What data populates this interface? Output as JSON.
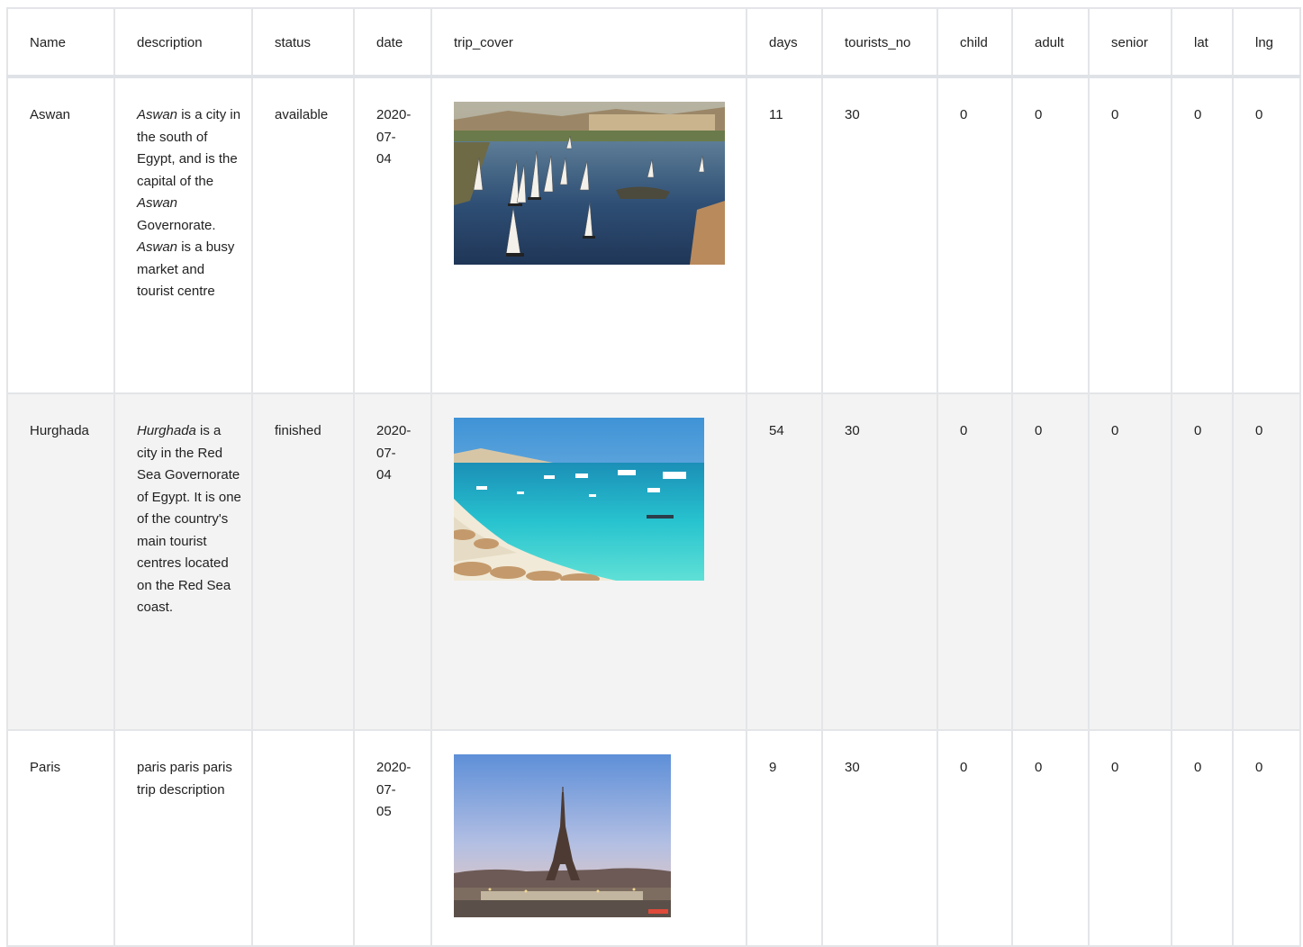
{
  "table": {
    "columns": [
      "Name",
      "description",
      "status",
      "date",
      "trip_cover",
      "days",
      "tourists_no",
      "child",
      "adult",
      "senior",
      "lat",
      "lng"
    ],
    "rows": [
      {
        "name": "Aswan",
        "desc": [
          {
            "t": "Aswan",
            "i": true
          },
          {
            "t": " is a city in the south of Egypt, and is the capital of the "
          },
          {
            "t": "Aswan",
            "i": true
          },
          {
            "t": "  Governorate. "
          },
          {
            "t": "Aswan",
            "i": true
          },
          {
            "t": " is a busy market and tourist centre"
          }
        ],
        "status": "available",
        "date": "2020-07-04",
        "cover": "aswan-nile-feluccas-photo",
        "days": "11",
        "tourists_no": "30",
        "child": "0",
        "adult": "0",
        "senior": "0",
        "lat": "0",
        "lng": "0"
      },
      {
        "name": "Hurghada",
        "desc": [
          {
            "t": "Hurghada",
            "i": true
          },
          {
            "t": " is a city in the Red Sea Governorate of Egypt. It is one of the country's main tourist centres located on the Red Sea coast."
          }
        ],
        "status": "finished",
        "date": "2020-07-04",
        "cover": "hurghada-beach-photo",
        "days": "54",
        "tourists_no": "30",
        "child": "0",
        "adult": "0",
        "senior": "0",
        "lat": "0",
        "lng": "0"
      },
      {
        "name": "Paris",
        "desc": [
          {
            "t": "paris paris paris trip description"
          }
        ],
        "status": "",
        "date": "2020-07-05",
        "cover": "paris-eiffel-tower-photo",
        "days": "9",
        "tourists_no": "30",
        "child": "0",
        "adult": "0",
        "senior": "0",
        "lat": "0",
        "lng": "0"
      }
    ]
  },
  "colors": {
    "border": "#e3e5e8",
    "stripe": "#f3f3f3",
    "text": "#222222"
  }
}
